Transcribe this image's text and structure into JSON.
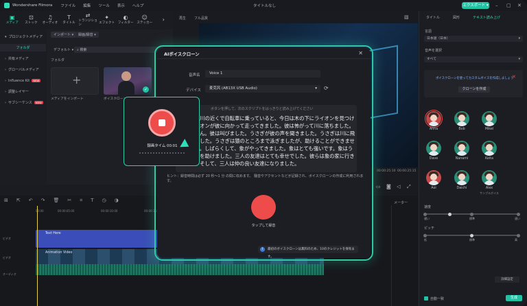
{
  "app": {
    "name": "Wondershare Filmora",
    "project_title": "タイトルなし",
    "export_label": "エクスポート"
  },
  "menu": [
    "ファイル",
    "編集",
    "ツール",
    "表示",
    "ヘルプ"
  ],
  "toolbar": [
    {
      "icon": "media-icon",
      "label": "メディア"
    },
    {
      "icon": "stock-icon",
      "label": "ストック"
    },
    {
      "icon": "audio-icon",
      "label": "オーディオ"
    },
    {
      "icon": "title-icon",
      "label": "タイトル"
    },
    {
      "icon": "transition-icon",
      "label": "トランジション"
    },
    {
      "icon": "effects-icon",
      "label": "エフェクト"
    },
    {
      "icon": "filter-icon",
      "label": "フィルター"
    },
    {
      "icon": "sticker-icon",
      "label": "ステッカー"
    }
  ],
  "sidebar": {
    "items": [
      "プロジェクトメディア",
      "フォルダ",
      "共有メディア",
      "グローバルメディア",
      "Influence Kit",
      "調整レイヤー",
      "サブシーケンス"
    ],
    "new_badge": "NEW"
  },
  "media": {
    "import_label": "インポート",
    "record_label": "録画/録音",
    "default_label": "デフォルト",
    "search_placeholder": "検索",
    "folder_label": "フォルダ",
    "import_tile_label": "メディアをインポート",
    "clip_label": "ボイスクローン..."
  },
  "preview": {
    "player_label": "再生",
    "quality_label": "フル品質",
    "time_left": "00:00:25:10",
    "time_right": "00:00:25:15"
  },
  "right_panel": {
    "tabs": [
      "タイトル",
      "図形",
      "テキスト読み上げ"
    ],
    "language_label": "言語",
    "language_value": "日本語（日本）",
    "voice_label": "音声を選択",
    "voice_value": "すべて",
    "clone_hint": "ボイスクローンを使ってカスタムボイスを作成しましょう",
    "clone_button": "クローンを作成",
    "voices": [
      "Anna",
      "Bob",
      "Mikel",
      "Dave",
      "Nanami",
      "Keita",
      "Aoi",
      "Daichi",
      "Alex"
    ],
    "voice_sub": "サンプルボイス",
    "speed_label": "速度",
    "speed_ticks": [
      "遅い",
      "標準",
      "速い"
    ],
    "pitch_label": "ピッチ",
    "pitch_ticks": [
      "低",
      "標準",
      "高"
    ],
    "auto_match": "自動一致",
    "generate": "生成",
    "settings": "詳細設定"
  },
  "dialog": {
    "title": "AIボイスクローン",
    "name_label": "音声名",
    "name_value": "Voice 1",
    "device_label": "デバイス",
    "device_value": "麦克风 (AB13X USB Audio)",
    "script_hint": "ボタンを押して、次のスクリプトをはっきりと読み上げてください",
    "script": "ネズミが川の近くで自転車に乗っていると、今日は木の下にライオンを見つけた。ライオンが彼に向かって走ってきました。彼は怖がって川に落ちました。泳げません。彼は叫びました。うさぎが彼の声を聞きました。うさぎは川に飛び込みました。うさぎは猿のところまで泳ぎましたが、助けることができませんでした。しばらくして、象がやってきました。象はとても強いです。象はうさぎと猿を助けました。三人の友達はとても幸せでした。彼らは象の家に行きました。そして、三人は仲の良い友達になりました。",
    "hint": "ヒント：録音時間は必ず 20 秒〜1 分 の間に収めます。 騒音やアクセントなどが記録され、ボイスクローンの作成に利用されます。",
    "record_label": "タップして録音",
    "notice": "最初のボイスクローンは無料のため、10のクレジットを保有ます。"
  },
  "record_popup": {
    "time_label": "録画タイム 00:01"
  },
  "timeline": {
    "ruler": [
      "00:00",
      "00:00:05:00",
      "00:00:10:00",
      "00:00:15:00",
      "00:00:20:00",
      "00:00:25:00",
      "00:00:30:00",
      "00:00:35:00"
    ],
    "text_clip": "Text Here",
    "video_clip": "Animation Video",
    "meter_label": "メーター",
    "track_labels": [
      "ビデオ",
      "ビデオ",
      "オーディオ"
    ]
  },
  "colors": {
    "accent": "#2de0b8",
    "record": "#ee4b4b",
    "dialog_bg": "#1d1e23",
    "text_track": "#3b4db8",
    "video_track": "#1d3a55"
  }
}
